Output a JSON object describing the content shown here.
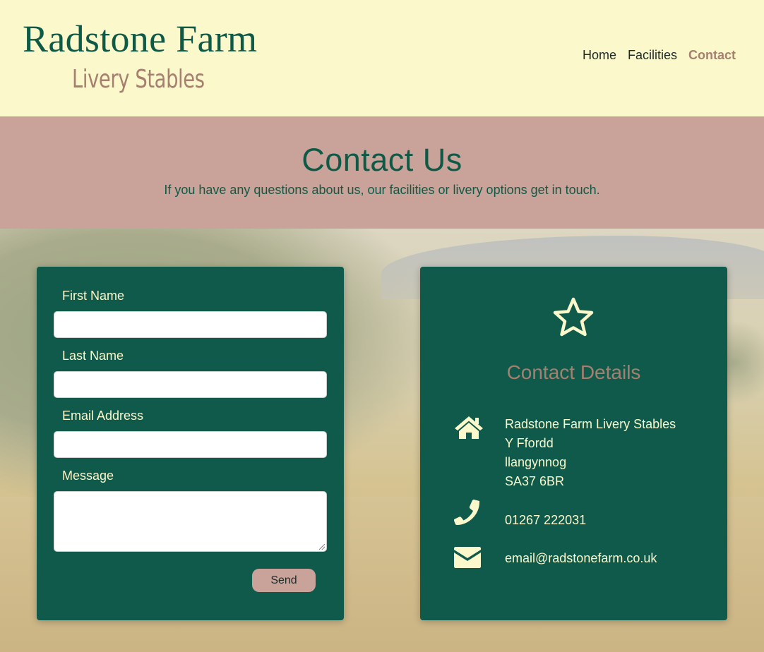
{
  "header": {
    "brand_title": "Radstone Farm",
    "brand_subtitle": "Livery Stables",
    "nav": [
      {
        "label": "Home",
        "active": false
      },
      {
        "label": "Facilities",
        "active": false
      },
      {
        "label": "Contact",
        "active": true
      }
    ]
  },
  "banner": {
    "title": "Contact Us",
    "text": "If you have any questions about us, our facilities or livery options get in touch."
  },
  "form": {
    "first_name_label": "First Name",
    "first_name_value": "",
    "last_name_label": "Last Name",
    "last_name_value": "",
    "email_label": "Email Address",
    "email_value": "",
    "message_label": "Message",
    "message_value": "",
    "send_label": "Send"
  },
  "details": {
    "icon": "star-icon",
    "title": "Contact Details",
    "address_icon": "home-icon",
    "address_lines": [
      "Radstone Farm Livery Stables",
      "Y Ffordd",
      "llangynnog",
      "SA37 6BR"
    ],
    "phone_icon": "phone-icon",
    "phone": "01267 222031",
    "email_icon": "envelope-icon",
    "email": "email@radstonefarm.co.uk"
  },
  "colors": {
    "cream": "#fbf8cc",
    "forest_green": "#0f5a4b",
    "rose": "#c9a39a",
    "mauve_text": "#a67f6f"
  }
}
